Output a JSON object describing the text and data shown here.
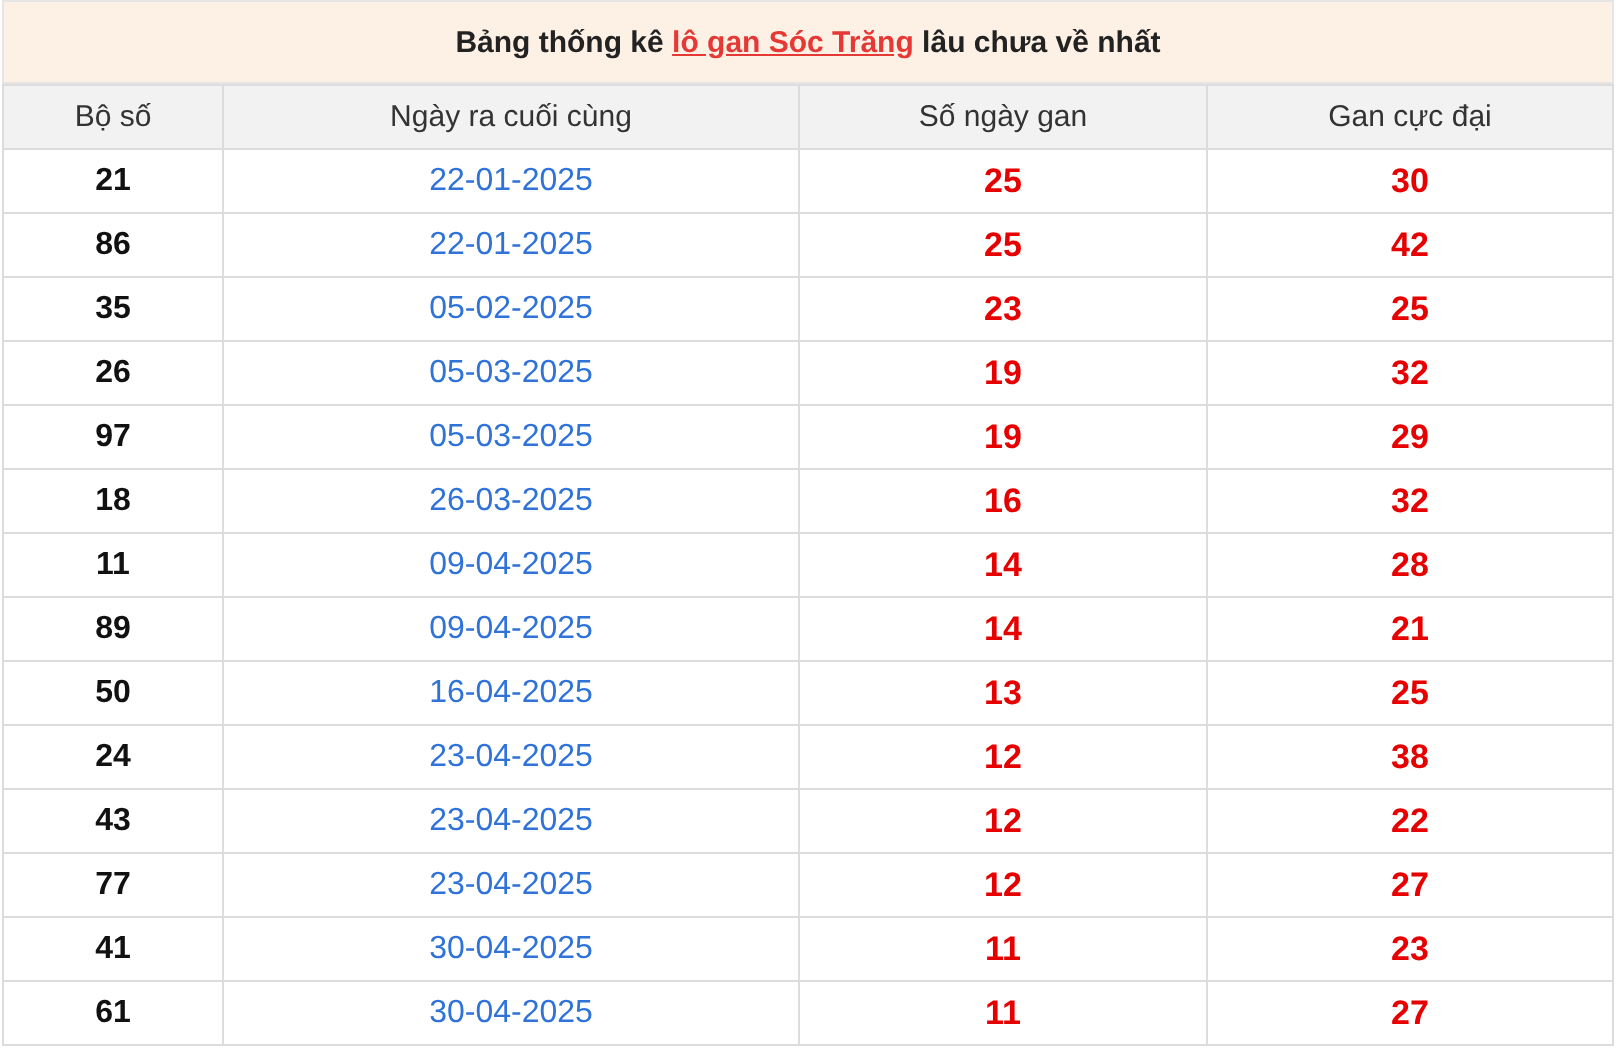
{
  "title": {
    "before": "Bảng thống kê ",
    "link": "lô gan Sóc Trăng",
    "after": " lâu chưa về nhất"
  },
  "table": {
    "columns": [
      "Bộ số",
      "Ngày ra cuối cùng",
      "Số ngày gan",
      "Gan cực đại"
    ],
    "rows": [
      [
        "21",
        "22-01-2025",
        "25",
        "30"
      ],
      [
        "86",
        "22-01-2025",
        "25",
        "42"
      ],
      [
        "35",
        "05-02-2025",
        "23",
        "25"
      ],
      [
        "26",
        "05-03-2025",
        "19",
        "32"
      ],
      [
        "97",
        "05-03-2025",
        "19",
        "29"
      ],
      [
        "18",
        "26-03-2025",
        "16",
        "32"
      ],
      [
        "11",
        "09-04-2025",
        "14",
        "28"
      ],
      [
        "89",
        "09-04-2025",
        "14",
        "21"
      ],
      [
        "50",
        "16-04-2025",
        "13",
        "25"
      ],
      [
        "24",
        "23-04-2025",
        "12",
        "38"
      ],
      [
        "43",
        "23-04-2025",
        "12",
        "22"
      ],
      [
        "77",
        "23-04-2025",
        "12",
        "27"
      ],
      [
        "41",
        "30-04-2025",
        "11",
        "23"
      ],
      [
        "61",
        "30-04-2025",
        "11",
        "27"
      ]
    ]
  }
}
